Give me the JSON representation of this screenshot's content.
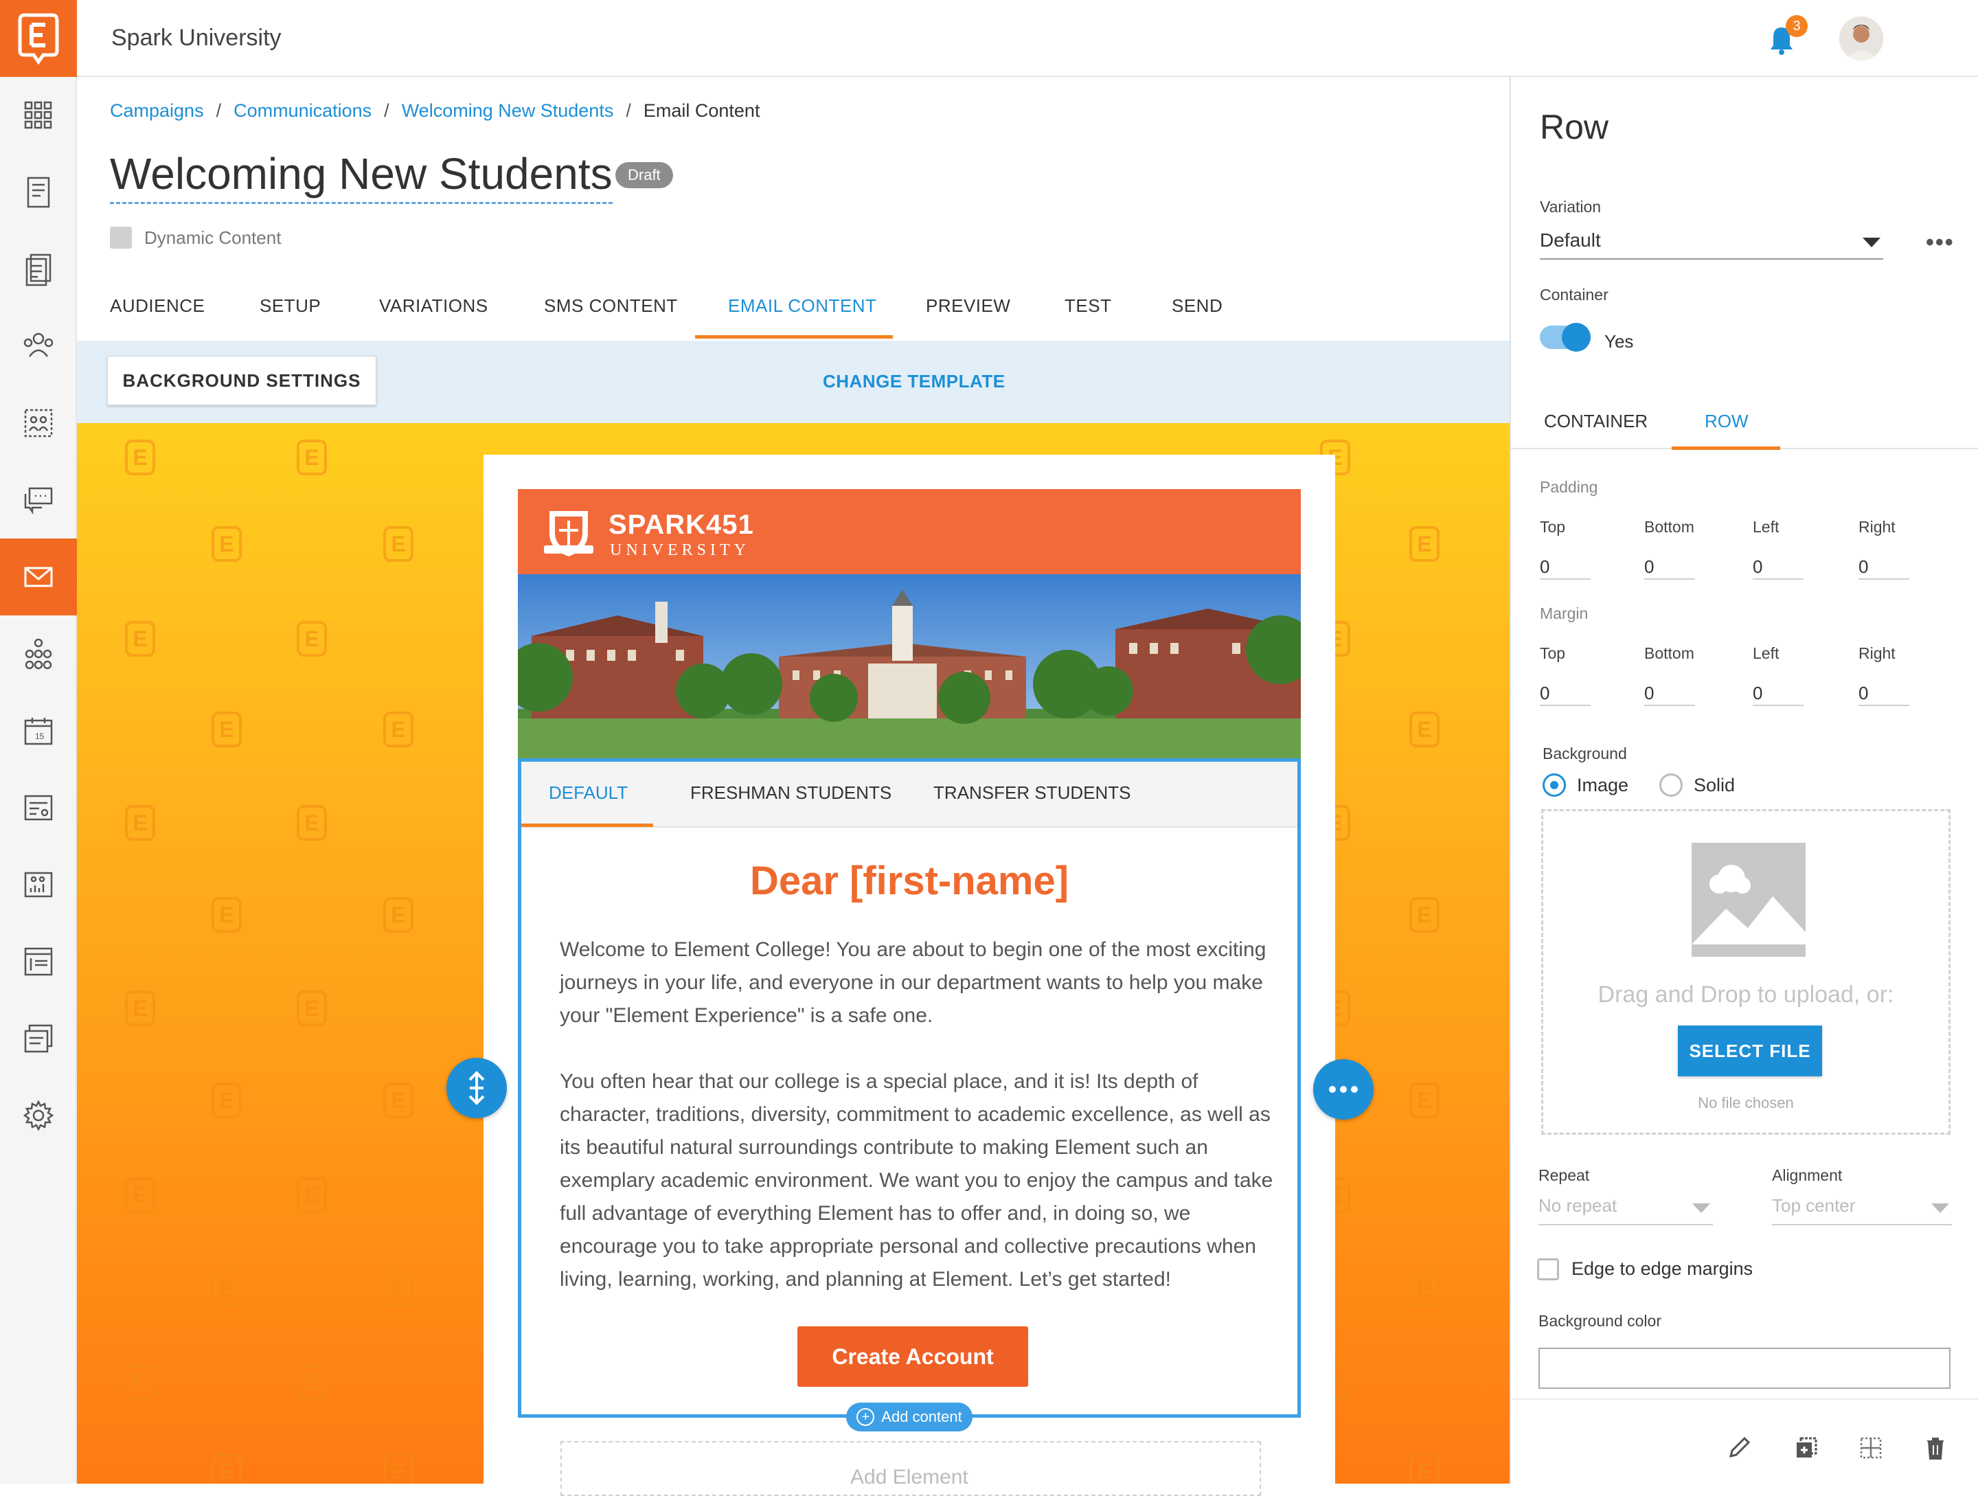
{
  "app": {
    "title": "Spark University"
  },
  "notifications": {
    "count": "3"
  },
  "breadcrumb": {
    "items": [
      "Campaigns",
      "Communications",
      "Welcoming New Students"
    ],
    "current": "Email Content"
  },
  "page": {
    "title": "Welcoming New Students",
    "status": "Draft",
    "dynamic_label": "Dynamic Content"
  },
  "tabs": [
    "AUDIENCE",
    "SETUP",
    "VARIATIONS",
    "SMS CONTENT",
    "EMAIL CONTENT",
    "PREVIEW",
    "TEST",
    "SEND"
  ],
  "active_tab": "EMAIL CONTENT",
  "toolbar": {
    "bg_settings": "BACKGROUND SETTINGS",
    "change_template": "CHANGE TEMPLATE"
  },
  "email": {
    "brand_name": "SPARK451",
    "brand_sub": "UNIVERSITY",
    "variation_tabs": [
      "DEFAULT",
      "FRESHMAN STUDENTS",
      "TRANSFER STUDENTS"
    ],
    "greeting": "Dear [first-name]",
    "para1": "Welcome to Element College! You are about to begin one of the most exciting journeys in your life, and everyone in our department wants to help you make your \"Element Experience\" is a safe one.",
    "para2": "You often hear that our college is a special place, and it is! Its depth of character, traditions, diversity, commitment to academic excellence, as well as its beautiful natural surroundings contribute to making Element such an exemplary academic environment. We want you to enjoy the campus and take full advantage of everything Element has to offer and, in doing so, we encourage you to take appropriate personal and collective precautions when living, learning, working, and planning at Element. Let’s get started!",
    "cta": "Create Account",
    "add_content": "Add content",
    "add_element": "Add Element"
  },
  "panel": {
    "title": "Row",
    "variation_label": "Variation",
    "variation_value": "Default",
    "container_label": "Container",
    "container_toggle": "Yes",
    "tabs": [
      "CONTAINER",
      "ROW"
    ],
    "padding_label": "Padding",
    "margin_label": "Margin",
    "side_labels": [
      "Top",
      "Bottom",
      "Left",
      "Right"
    ],
    "padding_values": [
      "0",
      "0",
      "0",
      "0"
    ],
    "margin_values": [
      "0",
      "0",
      "0",
      "0"
    ],
    "background_label": "Background",
    "bg_options": [
      "Image",
      "Solid"
    ],
    "drag_text": "Drag and Drop to upload, or:",
    "select_file": "SELECT FILE",
    "no_file": "No file chosen",
    "repeat_label": "Repeat",
    "repeat_value": "No repeat",
    "alignment_label": "Alignment",
    "alignment_value": "Top center",
    "edge_label": "Edge to edge margins",
    "bgcolor_label": "Background color"
  },
  "colors": {
    "brand_orange": "#f26a21",
    "accent_blue": "#1d8fd6",
    "tab_underline": "#f58220"
  }
}
